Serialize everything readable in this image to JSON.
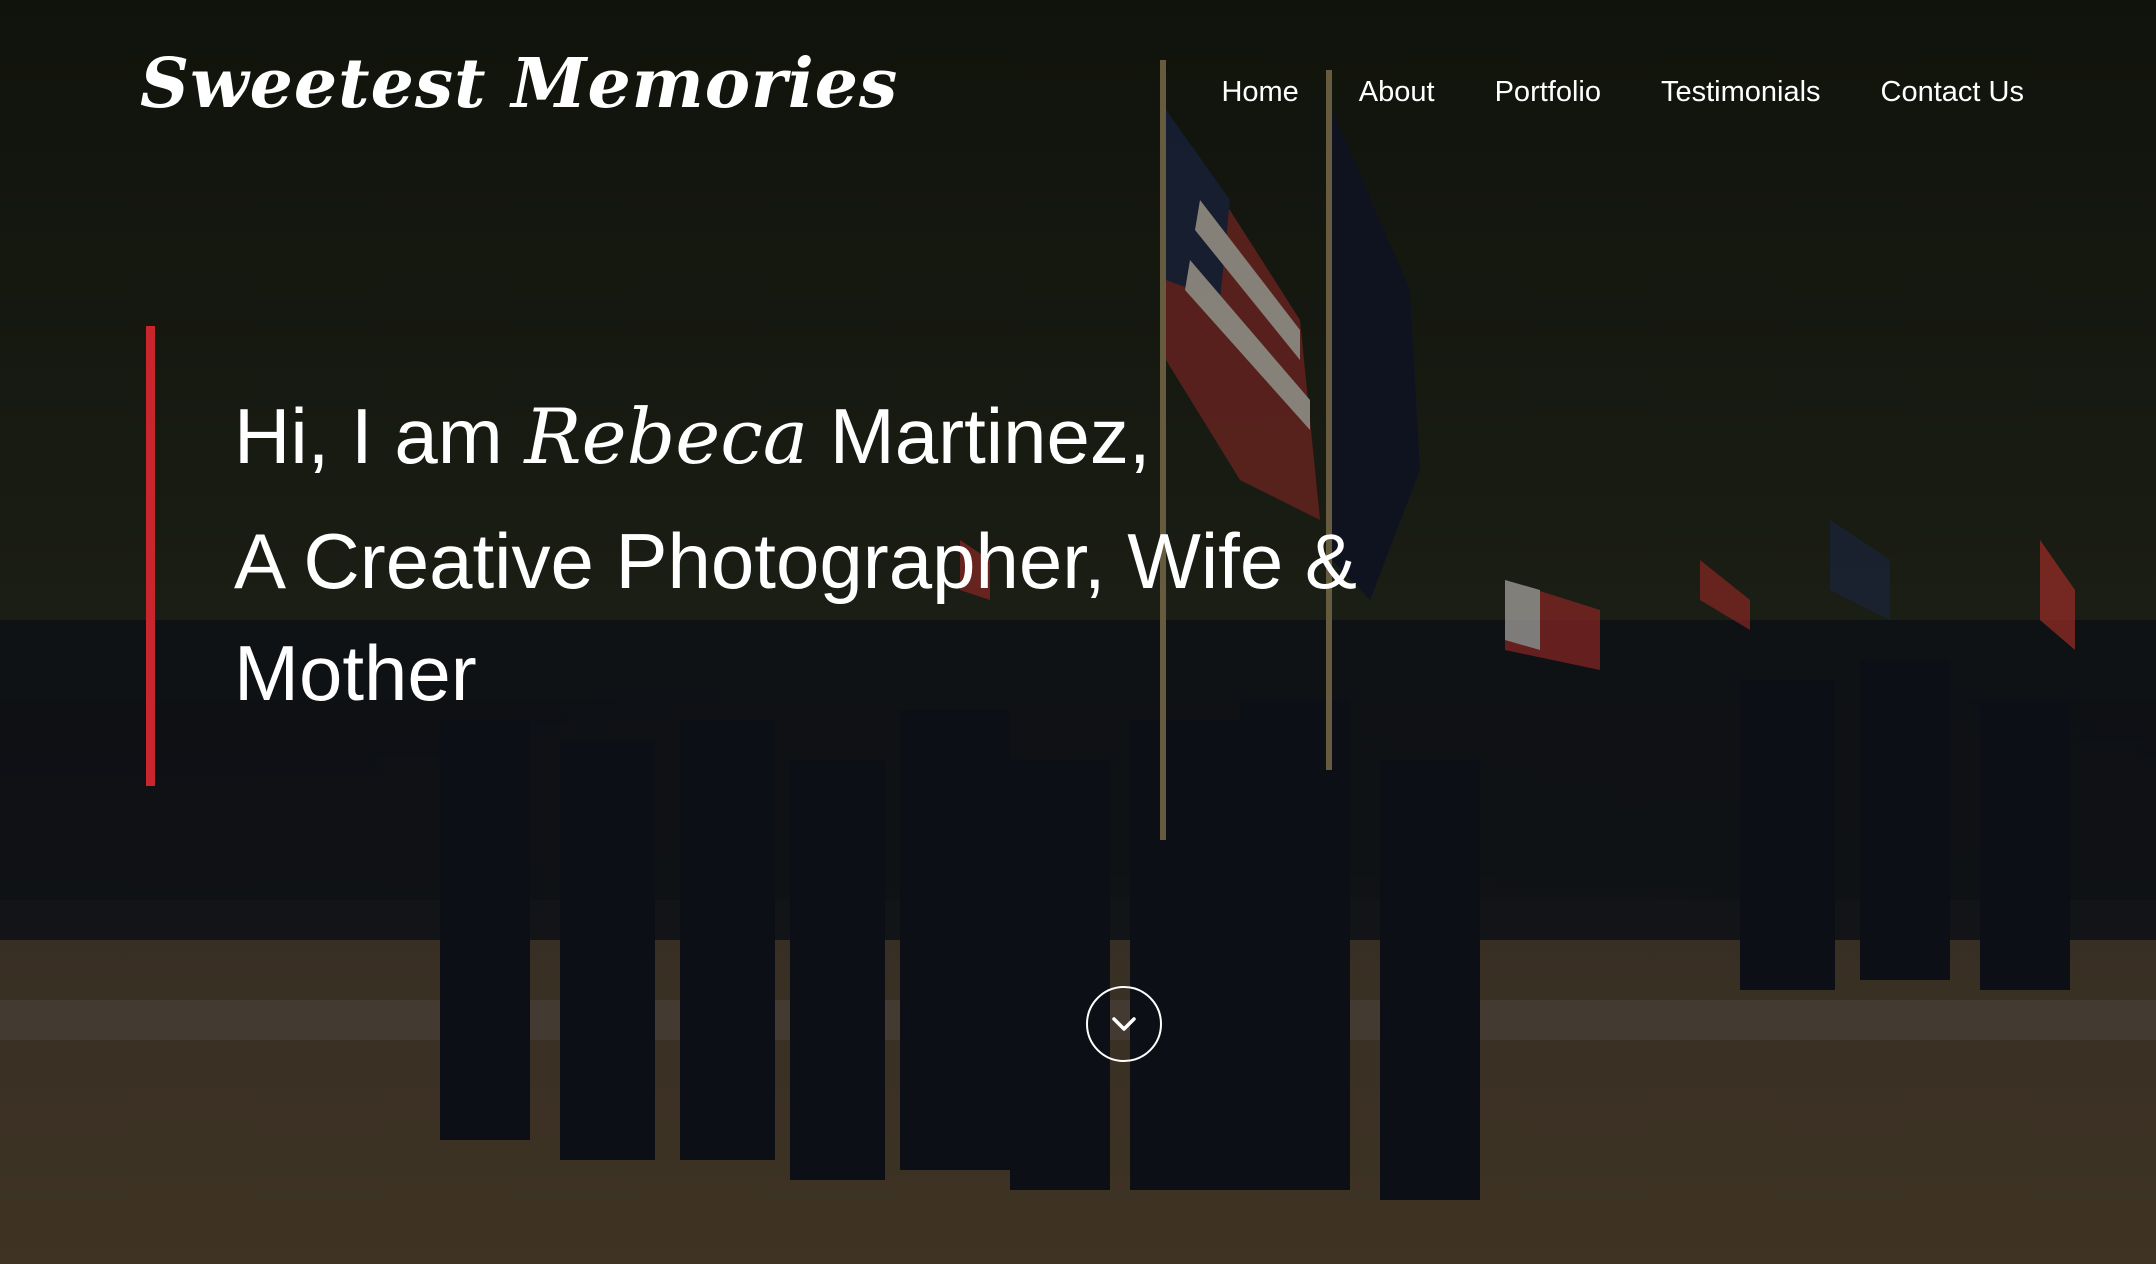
{
  "brand": {
    "name": "Sweetest Memories"
  },
  "nav": {
    "items": [
      {
        "label": "Home"
      },
      {
        "label": "About"
      },
      {
        "label": "Portfolio"
      },
      {
        "label": "Testimonials"
      },
      {
        "label": "Contact Us"
      }
    ]
  },
  "hero": {
    "greeting_prefix": "Hi, I am ",
    "first_name": "Rebeca",
    "last_name": " Martinez,",
    "tagline": "A Creative Photographer, Wife & Mother",
    "background_image": "military-graduation-ceremony-with-flags",
    "accent_color": "#c8262d",
    "scroll_icon": "chevron-down-icon"
  }
}
